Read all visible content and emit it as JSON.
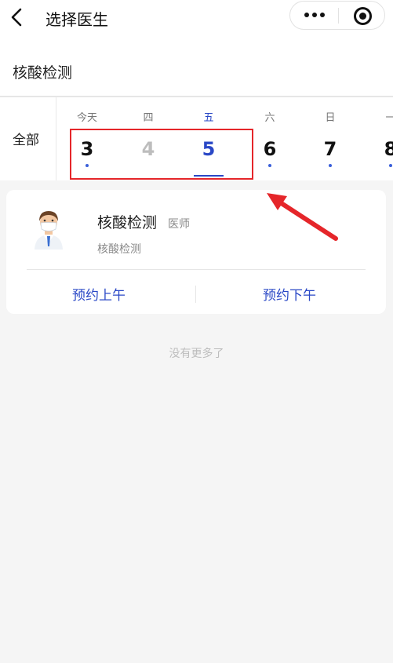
{
  "nav": {
    "title": "选择医生"
  },
  "department": {
    "name": "核酸检测"
  },
  "dates": {
    "all_label": "全部",
    "days": [
      {
        "weekday": "今天",
        "date": "3",
        "state": "available"
      },
      {
        "weekday": "四",
        "date": "4",
        "state": "disabled"
      },
      {
        "weekday": "五",
        "date": "5",
        "state": "selected"
      },
      {
        "weekday": "六",
        "date": "6",
        "state": "available"
      },
      {
        "weekday": "日",
        "date": "7",
        "state": "available"
      },
      {
        "weekday": "一",
        "date": "8",
        "state": "available"
      }
    ]
  },
  "doctor": {
    "name": "核酸检测",
    "title": "医师",
    "department": "核酸检测",
    "book_morning": "预约上午",
    "book_afternoon": "预约下午"
  },
  "footer": {
    "no_more": "没有更多了"
  },
  "colors": {
    "accent": "#2a48c6",
    "highlight": "#e5262a",
    "background": "#f5f5f5"
  }
}
